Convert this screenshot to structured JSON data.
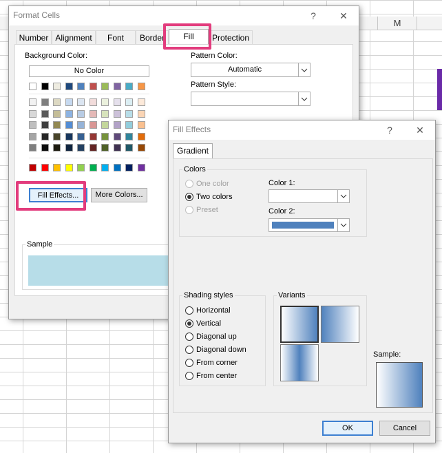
{
  "sheet": {
    "column_label": "M"
  },
  "format_cells": {
    "title": "Format Cells",
    "help": "?",
    "close": "✕",
    "tabs": [
      "Number",
      "Alignment",
      "Font",
      "Border",
      "Fill",
      "Protection"
    ],
    "background_color_label": "Background Color:",
    "no_color_label": "No Color",
    "pattern_color_label": "Pattern Color:",
    "pattern_color_value": "Automatic",
    "pattern_style_label": "Pattern Style:",
    "fill_effects_button": "Fill Effects...",
    "more_colors_button": "More Colors...",
    "sample_label": "Sample",
    "sample_color": "#b7dde8",
    "theme_row_1": [
      "#ffffff",
      "#000000",
      "#eeece1",
      "#1f497d",
      "#4f81bd",
      "#c0504d",
      "#9bbb59",
      "#8064a2",
      "#4bacc6",
      "#f79646"
    ],
    "theme_shades": [
      [
        "#f2f2f2",
        "#7f7f7f",
        "#ddd9c3",
        "#c6d9f0",
        "#dbe5f1",
        "#f2dcdb",
        "#ebf1dd",
        "#e5e0ec",
        "#dbeef3",
        "#fdeada"
      ],
      [
        "#d8d8d8",
        "#595959",
        "#c4bd97",
        "#8db3e2",
        "#b8cce4",
        "#e5b9b7",
        "#d7e3bc",
        "#ccc1d9",
        "#b7dde8",
        "#fbd5b5"
      ],
      [
        "#bfbfbf",
        "#3f3f3f",
        "#938953",
        "#548dd4",
        "#95b3d7",
        "#d99694",
        "#c3d69b",
        "#b2a2c7",
        "#92cddc",
        "#fac08f"
      ],
      [
        "#a5a5a5",
        "#262626",
        "#494429",
        "#17365d",
        "#366092",
        "#953734",
        "#76923c",
        "#5f497a",
        "#31859b",
        "#e36c09"
      ],
      [
        "#7f7f7f",
        "#0c0c0c",
        "#1d1b10",
        "#0f243e",
        "#244061",
        "#632423",
        "#4f6128",
        "#3f3151",
        "#205867",
        "#974806"
      ]
    ],
    "standard_colors": [
      "#c00000",
      "#ff0000",
      "#ffc000",
      "#ffff00",
      "#92d050",
      "#00b050",
      "#00b0f0",
      "#0070c0",
      "#002060",
      "#7030a0"
    ]
  },
  "fill_effects": {
    "title": "Fill Effects",
    "help": "?",
    "close": "✕",
    "tab": "Gradient",
    "colors_group": "Colors",
    "color_options": [
      "One color",
      "Two colors",
      "Preset"
    ],
    "selected_color_option": "Two colors",
    "color1_label": "Color 1:",
    "color2_label": "Color 2:",
    "color1_value": "#ffffff",
    "color2_value": "#4f81bd",
    "shading_group": "Shading styles",
    "shading_options": [
      "Horizontal",
      "Vertical",
      "Diagonal up",
      "Diagonal down",
      "From corner",
      "From center"
    ],
    "selected_shading": "Vertical",
    "variants_group": "Variants",
    "sample_label": "Sample:",
    "ok_button": "OK",
    "cancel_button": "Cancel"
  }
}
